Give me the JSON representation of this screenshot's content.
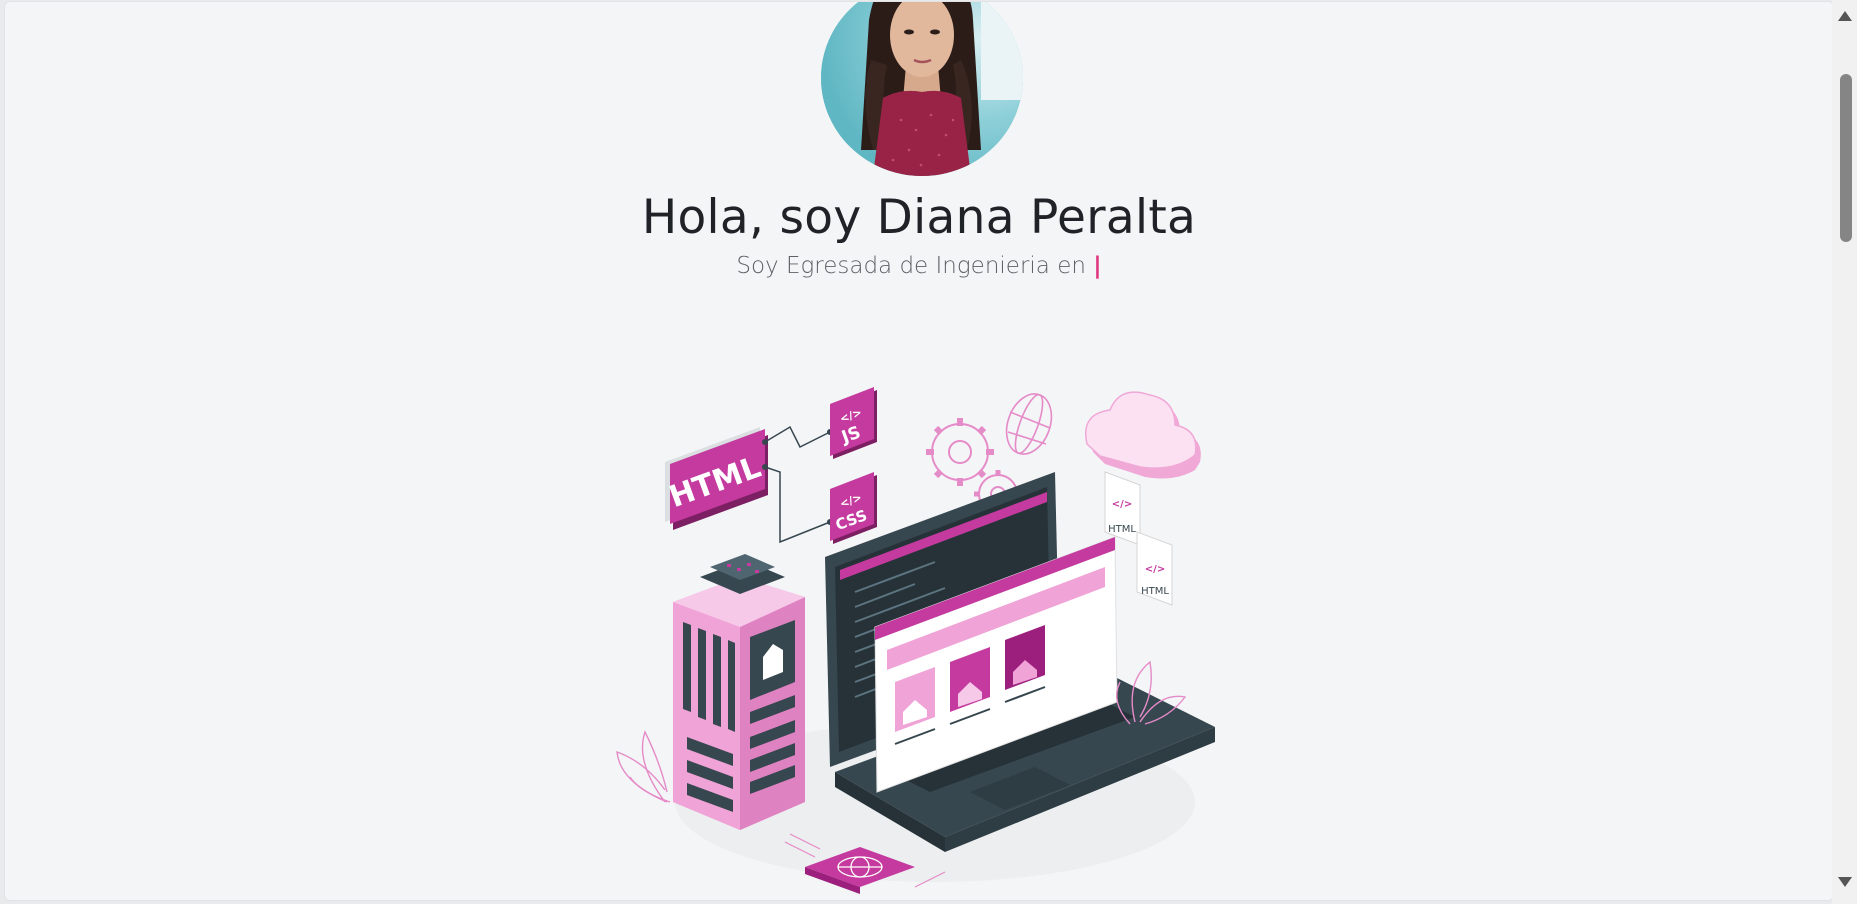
{
  "hero": {
    "title": "Hola, soy Diana Peralta",
    "subtitle_prefix": "Soy Egresada de Ingenieria en ",
    "typed_cursor": "|"
  },
  "illustration": {
    "html_label": "HTML",
    "js_label": "JS",
    "css_label": "CSS",
    "file_label_1": "HTML",
    "file_label_2": "HTML",
    "code_symbol": "</>"
  },
  "colors": {
    "accent": "#c43a9e",
    "accent_light": "#f1a7d8",
    "dark": "#37474f",
    "background": "#f4f5f7"
  },
  "icons": {
    "scroll_up": "triangle-up",
    "scroll_down": "triangle-down"
  }
}
